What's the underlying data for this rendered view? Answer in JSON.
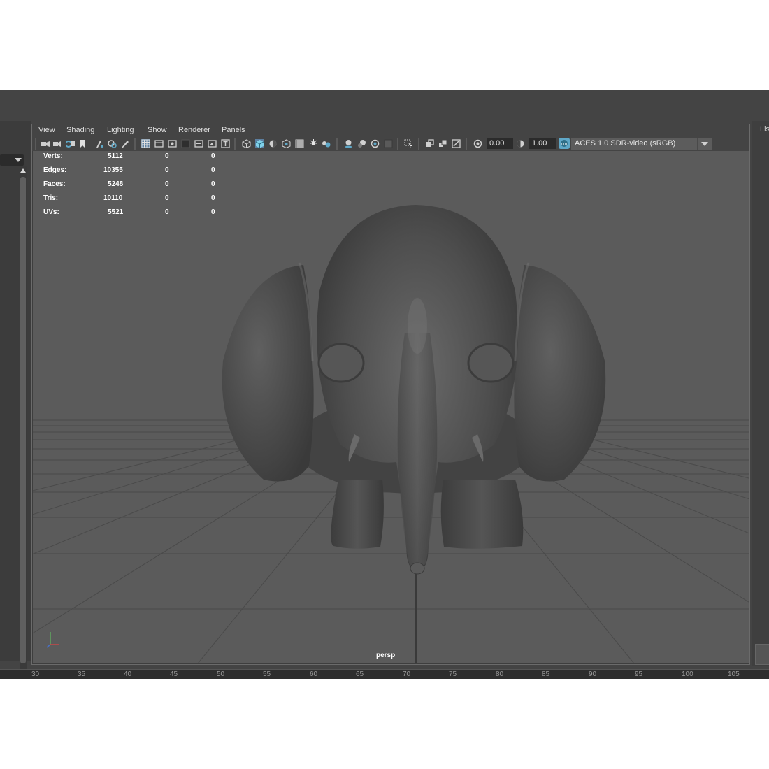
{
  "menu": [
    "View",
    "Shading",
    "Lighting",
    "Show",
    "Renderer",
    "Panels"
  ],
  "toolbar": {
    "exposure_value": "0.00",
    "gamma_value": "1.00",
    "colorspace": "ACES 1.0 SDR-video (sRGB)",
    "icons": [
      "select-camera-icon",
      "camera-attributes-icon",
      "bookmark-icon",
      "image-plane-icon",
      "2d-pan-zoom-icon",
      "grease-pencil-icon",
      "grid-icon",
      "film-gate-icon",
      "resolution-gate-icon",
      "gate-mask-icon",
      "field-chart-icon",
      "safe-action-icon",
      "safe-title-icon",
      "wireframe-icon",
      "smooth-shade-icon",
      "flat-lighting-icon",
      "bounding-box-icon",
      "textured-icon",
      "use-lights-icon",
      "shadows-icon",
      "screen-space-ao-icon",
      "motion-blur-icon",
      "anti-aliasing-icon",
      "depth-of-field-icon",
      "isolate-select-icon",
      "xray-icon",
      "xray-active-components-icon",
      "xray-joints-icon",
      "exposure-reset-icon",
      "gamma-reset-icon",
      "color-management-icon"
    ]
  },
  "hud": {
    "rows": [
      {
        "label": "Verts:",
        "v1": "5112",
        "v2": "0",
        "v3": "0"
      },
      {
        "label": "Edges:",
        "v1": "10355",
        "v2": "0",
        "v3": "0"
      },
      {
        "label": "Faces:",
        "v1": "5248",
        "v2": "0",
        "v3": "0"
      },
      {
        "label": "Tris:",
        "v1": "10110",
        "v2": "0",
        "v3": "0"
      },
      {
        "label": "UVs:",
        "v1": "5521",
        "v2": "0",
        "v3": "0"
      }
    ]
  },
  "viewport": {
    "camera": "persp",
    "model": "elephant-model"
  },
  "right_panel_label": "Lis",
  "timeline_ticks": [
    "30",
    "35",
    "40",
    "45",
    "50",
    "55",
    "60",
    "65",
    "70",
    "75",
    "80",
    "85",
    "90",
    "95",
    "100",
    "105"
  ],
  "colors": {
    "viewport_bg": "#5b5b5b",
    "ui_bg": "#444444",
    "accent": "#5fa8c8"
  }
}
